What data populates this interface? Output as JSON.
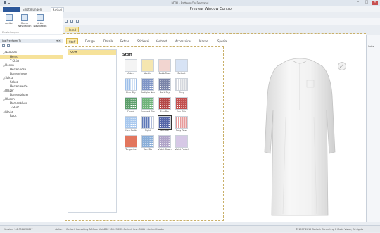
{
  "window": {
    "title": "MTM - Pattern On Demand",
    "controls": [
      "–",
      "□",
      "×"
    ]
  },
  "ribbon": {
    "subtitle": "Preview Window Control",
    "tabs": [
      "Einstellungen",
      "Artikel"
    ],
    "buttons": [
      "Artikel",
      "Obere Navigation",
      "Linke Navigation"
    ],
    "group": "Einstellungen"
  },
  "leftpanel": {
    "title": "Jag Freeform(?)",
    "tree": [
      {
        "label": "Hemden",
        "level": 0,
        "cat": true
      },
      {
        "label": "Hemd",
        "level": 1,
        "selected": true
      },
      {
        "label": "T-Shirt",
        "level": 1
      },
      {
        "label": "Hosen",
        "level": 0,
        "cat": true
      },
      {
        "label": "Herrenhose",
        "level": 1
      },
      {
        "label": "Damenhose",
        "level": 1
      },
      {
        "label": "Sakko",
        "level": 0,
        "cat": true
      },
      {
        "label": "Sakko",
        "level": 1
      },
      {
        "label": "Herrenweste",
        "level": 1
      },
      {
        "label": "Blazer",
        "level": 0,
        "cat": true
      },
      {
        "label": "Damenblazer",
        "level": 1
      },
      {
        "label": "Blusen",
        "level": 0,
        "cat": true
      },
      {
        "label": "Damenbluse",
        "level": 1
      },
      {
        "label": "T-Shirt",
        "level": 1
      },
      {
        "label": "Röcke",
        "level": 0,
        "cat": true
      },
      {
        "label": "Rock",
        "level": 1
      }
    ]
  },
  "main": {
    "doc_tab": "Hemd",
    "subtabs": [
      "Stoff",
      "Design",
      "Details",
      "Extras",
      "Stickerei",
      "Kontrast",
      "Accessoires",
      "Masse",
      "Spezial"
    ],
    "active_subtab": "Stoff",
    "list_header": "Stoff",
    "grid_title": "Stoff",
    "swatches": [
      {
        "label": "Adam",
        "color": "#f4f4f4",
        "pattern": "plain"
      },
      {
        "label": "Austin",
        "color": "#f5e6b0",
        "pattern": "plain"
      },
      {
        "label": "Babb Rose",
        "color": "#f2d5d0",
        "pattern": "plain"
      },
      {
        "label": "Belfast",
        "color": "#d7e3f5",
        "pattern": "plain"
      },
      {
        "label": "Blue Sky",
        "color": "#9fc0ea",
        "pattern": "stripe"
      },
      {
        "label": "Cadiglia Nav",
        "color": "#7f95c6",
        "pattern": "check"
      },
      {
        "label": "Dark Sky",
        "color": "#7a84a8",
        "pattern": "check"
      },
      {
        "label": "Grey",
        "color": "#d5d8de",
        "pattern": "stripe"
      },
      {
        "label": "Forest",
        "color": "#5c9e6a",
        "pattern": "check"
      },
      {
        "label": "Emerald Gre",
        "color": "#6eb37a",
        "pattern": "check"
      },
      {
        "label": "Erin Bar",
        "color": "#b44747",
        "pattern": "check"
      },
      {
        "label": "Erin Grid",
        "color": "#c25050",
        "pattern": "check"
      },
      {
        "label": "Neo Scrib",
        "color": "#a8c8ee",
        "pattern": "check"
      },
      {
        "label": "Night",
        "color": "#5f79b8",
        "pattern": "stripe"
      },
      {
        "label": "Nemesi",
        "color": "#5466a8",
        "pattern": "check"
      },
      {
        "label": "Rosy Rose",
        "color": "#e79b9b",
        "pattern": "stripe"
      },
      {
        "label": "Tangerine",
        "color": "#e2765e",
        "pattern": "plain"
      },
      {
        "label": "Tom Six",
        "color": "#8aaed8",
        "pattern": "check"
      },
      {
        "label": "Violet Dawn",
        "color": "#b0a4c8",
        "pattern": "check"
      },
      {
        "label": "Violet Pastel",
        "color": "#d6c8e6",
        "pattern": "plain"
      }
    ],
    "selected_swatch": "Nemesi"
  },
  "rightpanel": {
    "label": "Seite"
  },
  "statusbar": {
    "version": "Version: 1.0.3506.39827",
    "user": "stefan",
    "company": "Gerlach Consulting & Mode Vision",
    "server": "TSC 186.25.232:Gerlach test: 5001 - GerlachMaster",
    "copyright": "© 1997-2015 Gerlach Consulting & Mode Vision, All rights"
  }
}
